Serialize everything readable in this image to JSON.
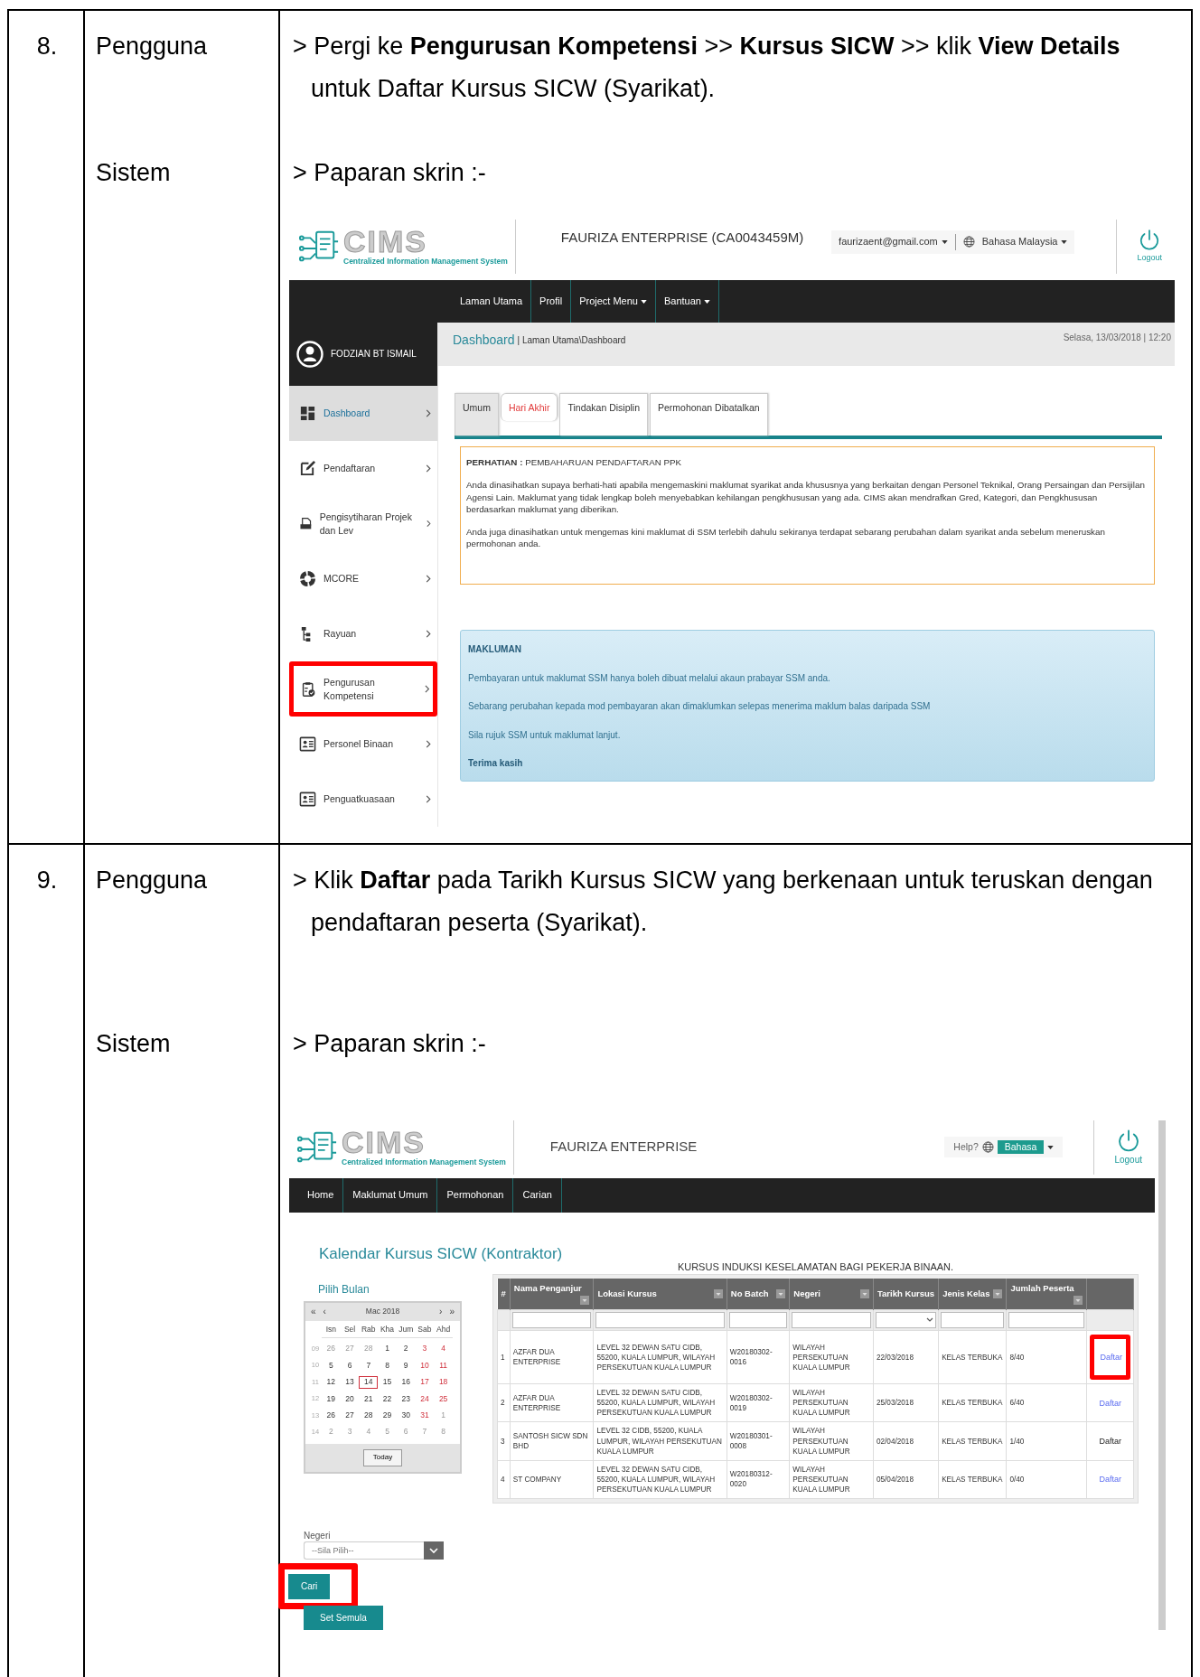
{
  "steps": [
    {
      "number": "8.",
      "user_label": "Pengguna",
      "user_instruction": "> Pergi ke **Pengurusan Kompetensi** >> **Kursus SICW** >> klik **View Details** untuk Daftar Kursus SICW (Syarikat).",
      "system_label": "Sistem",
      "system_instruction": "> Paparan skrin :-",
      "screen": {
        "kind": "dashboard",
        "logo_text": "CIMS",
        "logo_subtitle": "Centralized Information Management System",
        "company": "FAURIZA ENTERPRISE (CA0043459M)",
        "email": "faurizaent@gmail.com",
        "language": "Bahasa Malaysia",
        "logout": "Logout",
        "nav": [
          {
            "label": "Laman Utama",
            "dropdown": false
          },
          {
            "label": "Profil",
            "dropdown": false
          },
          {
            "label": "Project Menu",
            "dropdown": true
          },
          {
            "label": "Bantuan",
            "dropdown": true
          }
        ],
        "user_name": "FODZIAN BT ISMAIL",
        "sidebar": [
          {
            "label": "Dashboard",
            "selected": true,
            "highlighted": false
          },
          {
            "label": "Pendaftaran",
            "selected": false,
            "highlighted": false
          },
          {
            "label": "Pengisytiharan Projek dan Lev",
            "selected": false,
            "highlighted": false
          },
          {
            "label": "MCORE",
            "selected": false,
            "highlighted": false
          },
          {
            "label": "Rayuan",
            "selected": false,
            "highlighted": false
          },
          {
            "label": "Pengurusan Kompetensi",
            "selected": false,
            "highlighted": true
          },
          {
            "label": "Personel Binaan",
            "selected": false,
            "highlighted": false
          },
          {
            "label": "Penguatkuasaan",
            "selected": false,
            "highlighted": false
          }
        ],
        "breadcrumb": {
          "title": "Dashboard",
          "path": "| Laman Utama\\Dashboard"
        },
        "datetime": "Selasa, 13/03/2018 | 12:20",
        "tabs": [
          {
            "label": "Umum",
            "selected": true,
            "alert": false
          },
          {
            "label": "Hari Akhir",
            "selected": false,
            "alert": true
          },
          {
            "label": "Tindakan Disiplin",
            "selected": false,
            "alert": false
          },
          {
            "label": "Permohonan Dibatalkan",
            "selected": false,
            "alert": false
          }
        ],
        "notice": {
          "title": "**PERHATIAN :** PEMBAHARUAN PENDAFTARAN PPK",
          "paragraphs": [
            "Anda dinasihatkan supaya berhati-hati apabila mengemaskini maklumat syarikat anda khususnya yang berkaitan dengan Personel Teknikal, Orang Persaingan dan Persijilan Agensi Lain. Maklumat yang tidak lengkap boleh menyebabkan kehilangan pengkhususan yang ada. CIMS akan mendrafkan Gred, Kategori, dan Pengkhususan berdasarkan maklumat yang diberikan.",
            "Anda juga dinasihatkan untuk mengemas kini maklumat di SSM terlebih dahulu sekiranya terdapat sebarang perubahan dalam syarikat anda sebelum meneruskan permohonan anda."
          ]
        },
        "info": {
          "title": "MAKLUMAN",
          "paragraphs": [
            "Pembayaran untuk maklumat SSM hanya boleh dibuat melalui akaun prabayar SSM anda.",
            "Sebarang perubahan kepada mod pembayaran akan dimaklumkan selepas menerima maklum balas daripada SSM",
            "Sila rujuk SSM untuk maklumat lanjut."
          ],
          "closing": "Terima kasih"
        }
      }
    },
    {
      "number": "9.",
      "user_label": "Pengguna",
      "user_instruction": "> Klik **Daftar** pada Tarikh Kursus SICW yang berkenaan untuk teruskan dengan pendaftaran peserta (Syarikat).",
      "system_label": "Sistem",
      "system_instruction": "> Paparan skrin :-",
      "screen": {
        "kind": "course_calendar",
        "logo_text": "CIMS",
        "logo_subtitle": "Centralized Information Management System",
        "company": "FAURIZA ENTERPRISE",
        "help": "Help?",
        "language": "Bahasa",
        "logout": "Logout",
        "nav": [
          {
            "label": "Home"
          },
          {
            "label": "Maklumat Umum"
          },
          {
            "label": "Permohonan"
          },
          {
            "label": "Carian"
          }
        ],
        "title": "Kalendar Kursus SICW (Kontraktor)",
        "month_label": "Pilih Bulan",
        "calendar": {
          "nav_prev": [
            "«",
            "‹"
          ],
          "nav_next": [
            "›",
            "»"
          ],
          "month": "Mac 2018",
          "weekdays": [
            "Isn",
            "Sel",
            "Rab",
            "Kha",
            "Jum",
            "Sab",
            "Ahd"
          ],
          "today": "Today",
          "weeks": [
            {
              "number": "09",
              "days": [
                {
                  "text": "26",
                  "kind": "other",
                  "selected": false
                },
                {
                  "text": "27",
                  "kind": "other",
                  "selected": false
                },
                {
                  "text": "28",
                  "kind": "other",
                  "selected": false
                },
                {
                  "text": "1",
                  "kind": "normal",
                  "selected": false
                },
                {
                  "text": "2",
                  "kind": "normal",
                  "selected": false
                },
                {
                  "text": "3",
                  "kind": "weekend",
                  "selected": false
                },
                {
                  "text": "4",
                  "kind": "weekend",
                  "selected": false
                }
              ]
            },
            {
              "number": "10",
              "days": [
                {
                  "text": "5",
                  "kind": "normal",
                  "selected": false
                },
                {
                  "text": "6",
                  "kind": "normal",
                  "selected": false
                },
                {
                  "text": "7",
                  "kind": "normal",
                  "selected": false
                },
                {
                  "text": "8",
                  "kind": "normal",
                  "selected": false
                },
                {
                  "text": "9",
                  "kind": "normal",
                  "selected": false
                },
                {
                  "text": "10",
                  "kind": "weekend",
                  "selected": false
                },
                {
                  "text": "11",
                  "kind": "weekend",
                  "selected": false
                }
              ]
            },
            {
              "number": "11",
              "days": [
                {
                  "text": "12",
                  "kind": "normal",
                  "selected": false
                },
                {
                  "text": "13",
                  "kind": "normal",
                  "selected": false
                },
                {
                  "text": "14",
                  "kind": "normal",
                  "selected": true
                },
                {
                  "text": "15",
                  "kind": "normal",
                  "selected": false
                },
                {
                  "text": "16",
                  "kind": "normal",
                  "selected": false
                },
                {
                  "text": "17",
                  "kind": "weekend",
                  "selected": false
                },
                {
                  "text": "18",
                  "kind": "weekend",
                  "selected": false
                }
              ]
            },
            {
              "number": "12",
              "days": [
                {
                  "text": "19",
                  "kind": "normal",
                  "selected": false
                },
                {
                  "text": "20",
                  "kind": "normal",
                  "selected": false
                },
                {
                  "text": "21",
                  "kind": "normal",
                  "selected": false
                },
                {
                  "text": "22",
                  "kind": "normal",
                  "selected": false
                },
                {
                  "text": "23",
                  "kind": "normal",
                  "selected": false
                },
                {
                  "text": "24",
                  "kind": "weekend",
                  "selected": false
                },
                {
                  "text": "25",
                  "kind": "weekend",
                  "selected": false
                }
              ]
            },
            {
              "number": "13",
              "days": [
                {
                  "text": "26",
                  "kind": "normal",
                  "selected": false
                },
                {
                  "text": "27",
                  "kind": "normal",
                  "selected": false
                },
                {
                  "text": "28",
                  "kind": "normal",
                  "selected": false
                },
                {
                  "text": "29",
                  "kind": "normal",
                  "selected": false
                },
                {
                  "text": "30",
                  "kind": "normal",
                  "selected": false
                },
                {
                  "text": "31",
                  "kind": "weekend",
                  "selected": false
                },
                {
                  "text": "1",
                  "kind": "other",
                  "selected": false
                }
              ]
            },
            {
              "number": "14",
              "days": [
                {
                  "text": "2",
                  "kind": "other",
                  "selected": false
                },
                {
                  "text": "3",
                  "kind": "other",
                  "selected": false
                },
                {
                  "text": "4",
                  "kind": "other",
                  "selected": false
                },
                {
                  "text": "5",
                  "kind": "other",
                  "selected": false
                },
                {
                  "text": "6",
                  "kind": "other",
                  "selected": false
                },
                {
                  "text": "7",
                  "kind": "other",
                  "selected": false
                },
                {
                  "text": "8",
                  "kind": "other",
                  "selected": false
                }
              ]
            }
          ]
        },
        "state_label": "Negeri",
        "state_placeholder": "--Sila Pilih--",
        "buttons": [
          {
            "label": "Cari",
            "highlighted": true
          },
          {
            "label": "Set Semula",
            "highlighted": false
          }
        ],
        "table": {
          "title": "KURSUS INDUKSI KESELAMATAN BAGI PEKERJA BINAAN.",
          "columns": [
            {
              "label": "#",
              "filter": false,
              "kind": "plain"
            },
            {
              "label": "Nama Penganjur",
              "filter": true,
              "kind": "text"
            },
            {
              "label": "Lokasi Kursus",
              "filter": true,
              "kind": "text"
            },
            {
              "label": "No Batch",
              "filter": true,
              "kind": "text"
            },
            {
              "label": "Negeri",
              "filter": true,
              "kind": "text"
            },
            {
              "label": "Tarikh Kursus",
              "filter": false,
              "kind": "select"
            },
            {
              "label": "Jenis Kelas",
              "filter": true,
              "kind": "text"
            },
            {
              "label": "Jumlah Peserta",
              "filter": true,
              "kind": "text"
            },
            {
              "filter": false,
              "kind": "plain"
            }
          ],
          "rows": [
            {
              "number": "1",
              "organizer": "AZFAR DUA ENTERPRISE",
              "location": "LEVEL 32 DEWAN SATU CIDB, 55200, KUALA LUMPUR, WILAYAH PERSEKUTUAN KUALA LUMPUR",
              "batch": "W20180302-0016",
              "state": "WILAYAH PERSEKUTUAN KUALA LUMPUR",
              "date": "22/03/2018",
              "class_type": "KELAS TERBUKA",
              "participants": "8/40",
              "action": "Daftar",
              "disabled": false,
              "highlighted": true
            },
            {
              "number": "2",
              "organizer": "AZFAR DUA ENTERPRISE",
              "location": "LEVEL 32 DEWAN SATU CIDB, 55200, KUALA LUMPUR, WILAYAH PERSEKUTUAN KUALA LUMPUR",
              "batch": "W20180302-0019",
              "state": "WILAYAH PERSEKUTUAN KUALA LUMPUR",
              "date": "25/03/2018",
              "class_type": "KELAS TERBUKA",
              "participants": "6/40",
              "action": "Daftar",
              "disabled": false,
              "highlighted": false
            },
            {
              "number": "3",
              "organizer": "SANTOSH SICW SDN BHD",
              "location": "LEVEL 32 CIDB, 55200, KUALA LUMPUR, WILAYAH PERSEKUTUAN KUALA LUMPUR",
              "batch": "W20180301-0008",
              "state": "WILAYAH PERSEKUTUAN KUALA LUMPUR",
              "date": "02/04/2018",
              "class_type": "KELAS TERBUKA",
              "participants": "1/40",
              "action": "Daftar",
              "disabled": true,
              "highlighted": false
            },
            {
              "number": "4",
              "organizer": "ST COMPANY",
              "location": "LEVEL 32 DEWAN SATU CIDB, 55200, KUALA LUMPUR, WILAYAH PERSEKUTUAN KUALA LUMPUR",
              "batch": "W20180312-0020",
              "state": "WILAYAH PERSEKUTUAN KUALA LUMPUR",
              "date": "05/04/2018",
              "class_type": "KELAS TERBUKA",
              "participants": "0/40",
              "action": "Daftar",
              "disabled": false,
              "highlighted": false
            }
          ]
        }
      }
    }
  ]
}
